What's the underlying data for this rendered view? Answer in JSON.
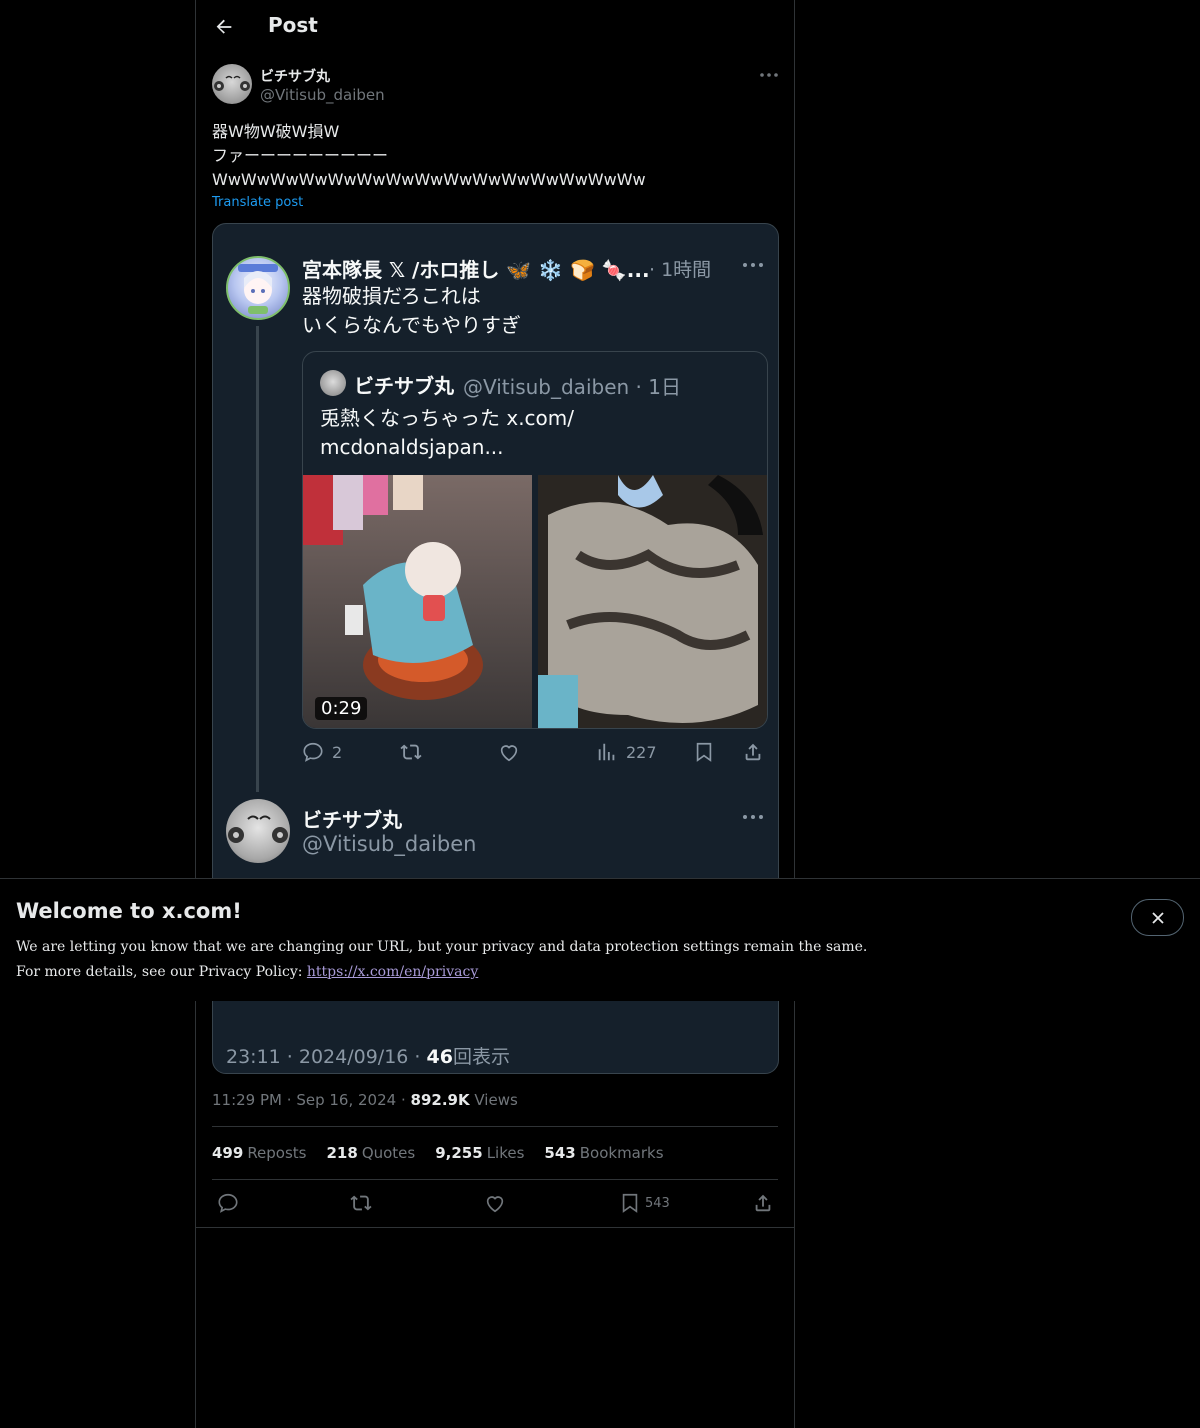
{
  "header": {
    "title": "Post"
  },
  "post": {
    "author_name": "ビチサブ丸",
    "author_handle": "@Vitisub_daiben",
    "text_lines": [
      "器W物W破W損W",
      "ファーーーーーーーーー",
      "WwWwWwWwWwWwWwWwWwWwWwWwWwWwWw"
    ],
    "translate_label": "Translate post",
    "time": "11:29 PM",
    "date": "Sep 16, 2024",
    "views_count": "892.9K",
    "views_label": "Views",
    "separator": "·"
  },
  "screenshot": {
    "quote_author": "宮本隊長 𝕏 /ホロ推し 🦋 ❄️ 🍞 🍬...",
    "quote_time": "· 1時間",
    "quote_text_lines": [
      "器物破損だろこれは",
      "いくらなんでもやりすぎ"
    ],
    "inner_author": "ビチサブ丸",
    "inner_handle_time": "@Vitisub_daiben · 1日",
    "inner_text_lines": [
      "兎熱くなっちゃった x.com/",
      "mcdonaldsjapan..."
    ],
    "video_duration": "0:29",
    "replies": "2",
    "views": "227",
    "reply_author": "ビチサブ丸",
    "reply_handle": "@Vitisub_daiben",
    "meta_prefix": "23:11 · 2024/09/16 ·",
    "meta_count": "46",
    "meta_suffix": "回表示"
  },
  "stats": {
    "reposts": "499",
    "reposts_label": "Reposts",
    "quotes": "218",
    "quotes_label": "Quotes",
    "likes": "9,255",
    "likes_label": "Likes",
    "bookmarks": "543",
    "bookmarks_label": "Bookmarks"
  },
  "actions": {
    "bookmark_count": "543"
  },
  "banner": {
    "title": "Welcome to x.com!",
    "line1": "We are letting you know that we are changing our URL, but your privacy and data protection settings remain the same.",
    "line2_prefix": "For more details, see our Privacy Policy:",
    "link": "https://x.com/en/privacy"
  },
  "colors": {
    "accent": "#1d9bf0",
    "background": "#000000",
    "embed_bg": "#15202b"
  }
}
